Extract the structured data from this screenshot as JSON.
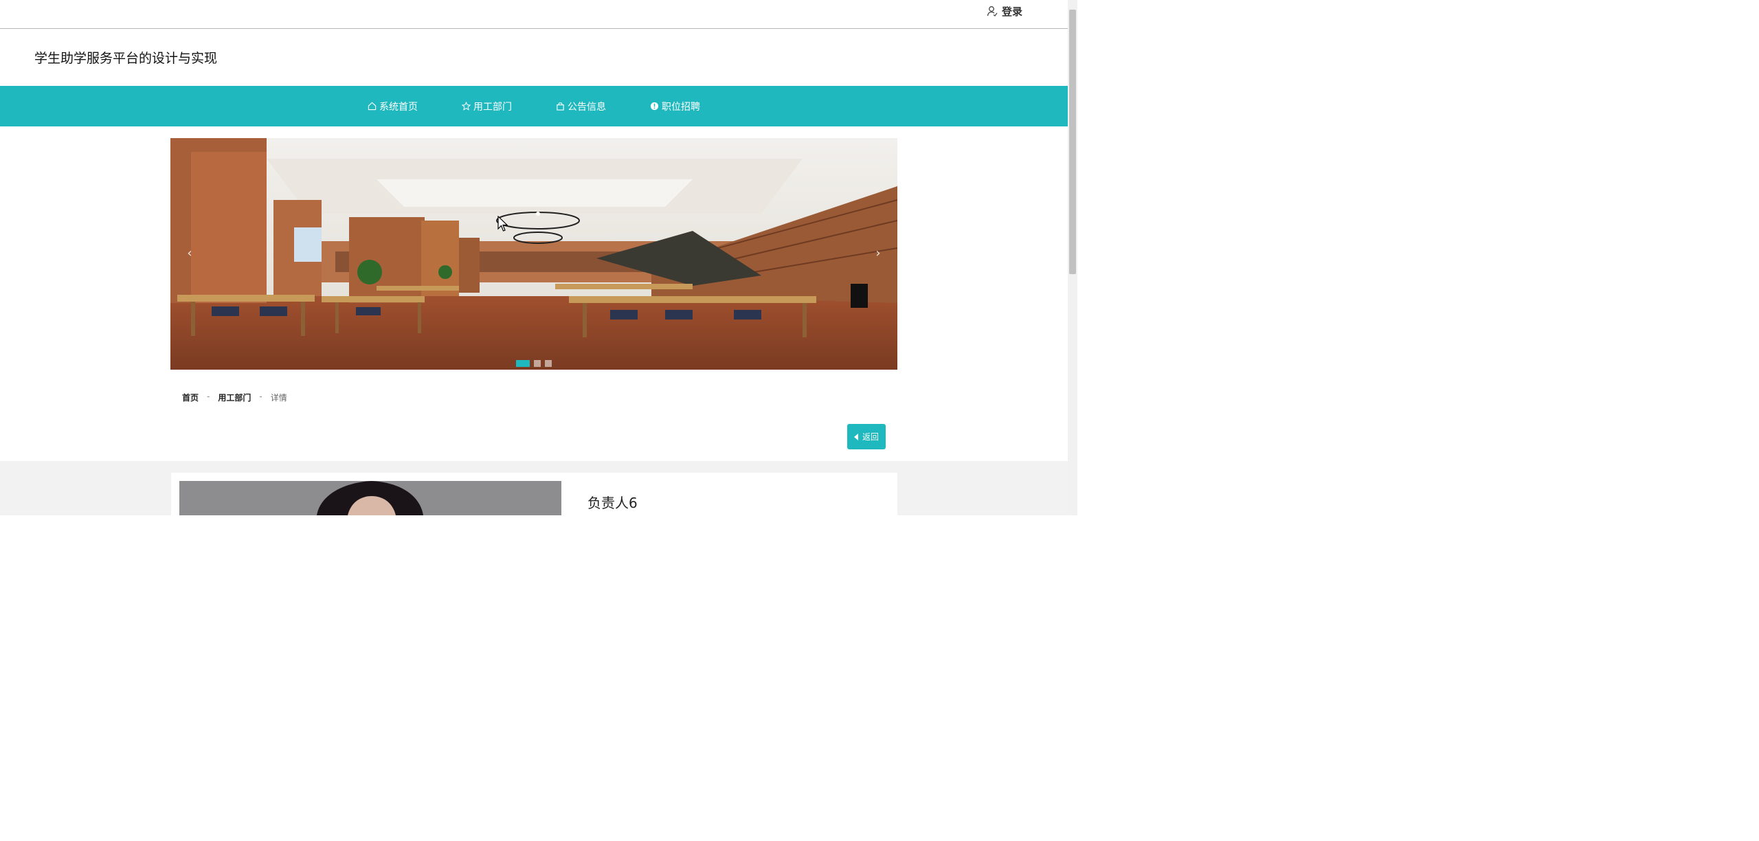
{
  "topbar": {
    "login_label": "登录"
  },
  "header": {
    "title": "学生助学服务平台的设计与实现"
  },
  "nav": {
    "items": [
      {
        "label": "系统首页",
        "icon": "home-icon"
      },
      {
        "label": "用工部门",
        "icon": "star-icon"
      },
      {
        "label": "公告信息",
        "icon": "bag-icon"
      },
      {
        "label": "职位招聘",
        "icon": "info-icon"
      }
    ]
  },
  "carousel": {
    "prev_label": "‹",
    "next_label": "›",
    "slides": 3,
    "active": 1
  },
  "breadcrumb": {
    "home": "首页",
    "section": "用工部门",
    "current": "详情",
    "separator": "-"
  },
  "back_button": {
    "label": "返回"
  },
  "detail": {
    "name": "负责人6"
  },
  "colors": {
    "accent": "#1fb8be"
  }
}
